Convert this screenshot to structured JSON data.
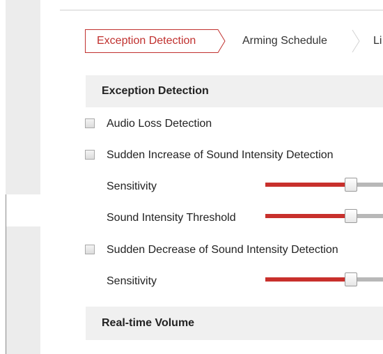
{
  "tabs": [
    {
      "label": "Exception Detection",
      "active": true
    },
    {
      "label": "Arming Schedule",
      "active": false
    },
    {
      "label": "Li",
      "active": false
    }
  ],
  "sections": {
    "exception_detection": {
      "title": "Exception Detection"
    },
    "realtime_volume": {
      "title": "Real-time Volume"
    }
  },
  "options": {
    "audio_loss": {
      "label": "Audio Loss Detection",
      "checked": false
    },
    "sudden_increase": {
      "label": "Sudden Increase of Sound Intensity Detection",
      "checked": false
    },
    "sudden_decrease": {
      "label": "Sudden Decrease of Sound Intensity Detection",
      "checked": false
    }
  },
  "sliders": {
    "increase_sensitivity": {
      "label": "Sensitivity",
      "level_fraction": 0.73
    },
    "increase_threshold": {
      "label": "Sound Intensity Threshold",
      "level_fraction": 0.73
    },
    "decrease_sensitivity": {
      "label": "Sensitivity",
      "level_fraction": 0.73
    }
  },
  "colors": {
    "accent": "#c0302e",
    "slider_fill": "#c8302c",
    "slider_rest": "#b8b8b8",
    "section_bg": "#f0f0f0"
  }
}
